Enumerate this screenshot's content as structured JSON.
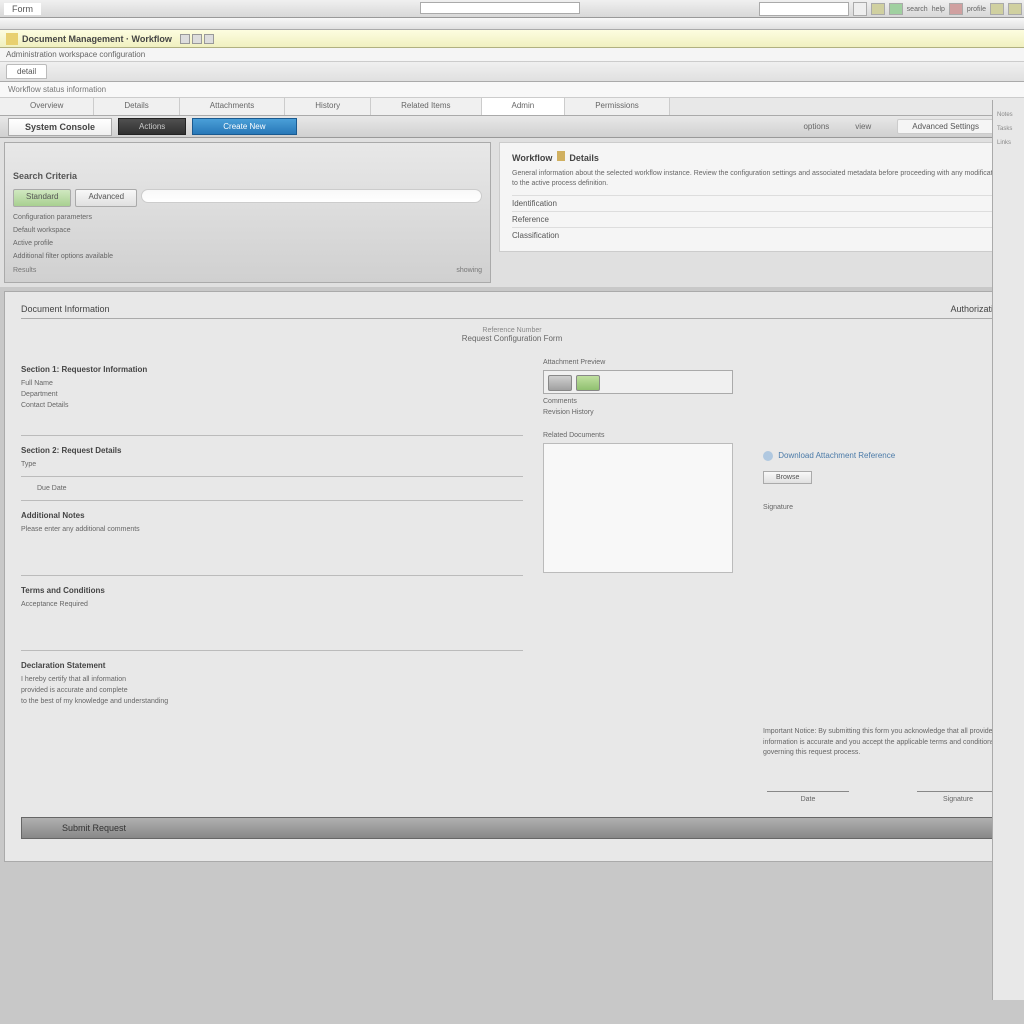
{
  "browser": {
    "tab_label": "Form",
    "address_placeholder": ""
  },
  "titlebar": {
    "title": "Document Management · Workflow",
    "subtitle": "Administration workspace configuration"
  },
  "tabrow": {
    "tab1": "detail"
  },
  "status": {
    "item1": "Workflow status information"
  },
  "navtabs": {
    "t1": "Overview",
    "t2": "Details",
    "t3": "Attachments",
    "t4": "History",
    "t5": "Related Items",
    "t6": "Admin",
    "t7": "Permissions"
  },
  "actionbar": {
    "breadcrumb": "System Console",
    "btn_dark": "Actions",
    "btn_blue": "Create New",
    "link1": "options",
    "link2": "view",
    "pill": "Advanced Settings",
    "help": "?"
  },
  "left_panel": {
    "header": "Search Criteria",
    "tab_active": "Standard",
    "tab_other": "Advanced",
    "desc1": "Configuration parameters",
    "desc2": "Default workspace",
    "desc3": "Active profile",
    "desc4": "Additional filter options available",
    "footer_left": "Results",
    "footer_right": "showing"
  },
  "info_panel": {
    "title_a": "Workflow",
    "title_b": "Details",
    "description": "General information about the selected workflow instance. Review the configuration settings and associated metadata before proceeding with any modifications to the active process definition.",
    "row1": "Identification",
    "row2": "Reference",
    "row3": "Classification"
  },
  "form": {
    "header_left": "Document Information",
    "header_right": "Authorization",
    "center_sub": "Reference Number",
    "center_main": "Request Configuration Form",
    "sec1_title": "Section 1: Requestor Information",
    "sec1_f1": "Full Name",
    "sec1_f2": "Department",
    "sec1_f3": "Contact Details",
    "sec2_title": "Section 2: Request Details",
    "sec2_f1": "Type",
    "sec2_f2": "Due Date",
    "sec3_title": "Additional Notes",
    "sec3_f1": "Please enter any additional comments",
    "sec4_title": "Terms and Conditions",
    "sec4_f1": "Acceptance Required",
    "sec5_title": "Declaration Statement",
    "sec5_f1": "I hereby certify that all information",
    "sec5_f2": "provided is accurate and complete",
    "sec5_f3": "to the best of my knowledge and understanding",
    "mid_label1": "Attachment Preview",
    "mid_label2": "Comments",
    "mid_label3": "Revision History",
    "mid_label4": "Related Documents",
    "right_link": "Download Attachment Reference",
    "right_btn": "Browse",
    "right_label": "Signature",
    "disclaimer": "Important Notice: By submitting this form you acknowledge that all provided information is accurate and you accept the applicable terms and conditions governing this request process.",
    "sig_left": "Date",
    "sig_right": "Signature",
    "submit": "Submit Request"
  },
  "topright": {
    "t1": "search",
    "t2": "help",
    "t3": "profile"
  },
  "sidebar": {
    "i1": "Notes",
    "i2": "Tasks",
    "i3": "Links"
  }
}
